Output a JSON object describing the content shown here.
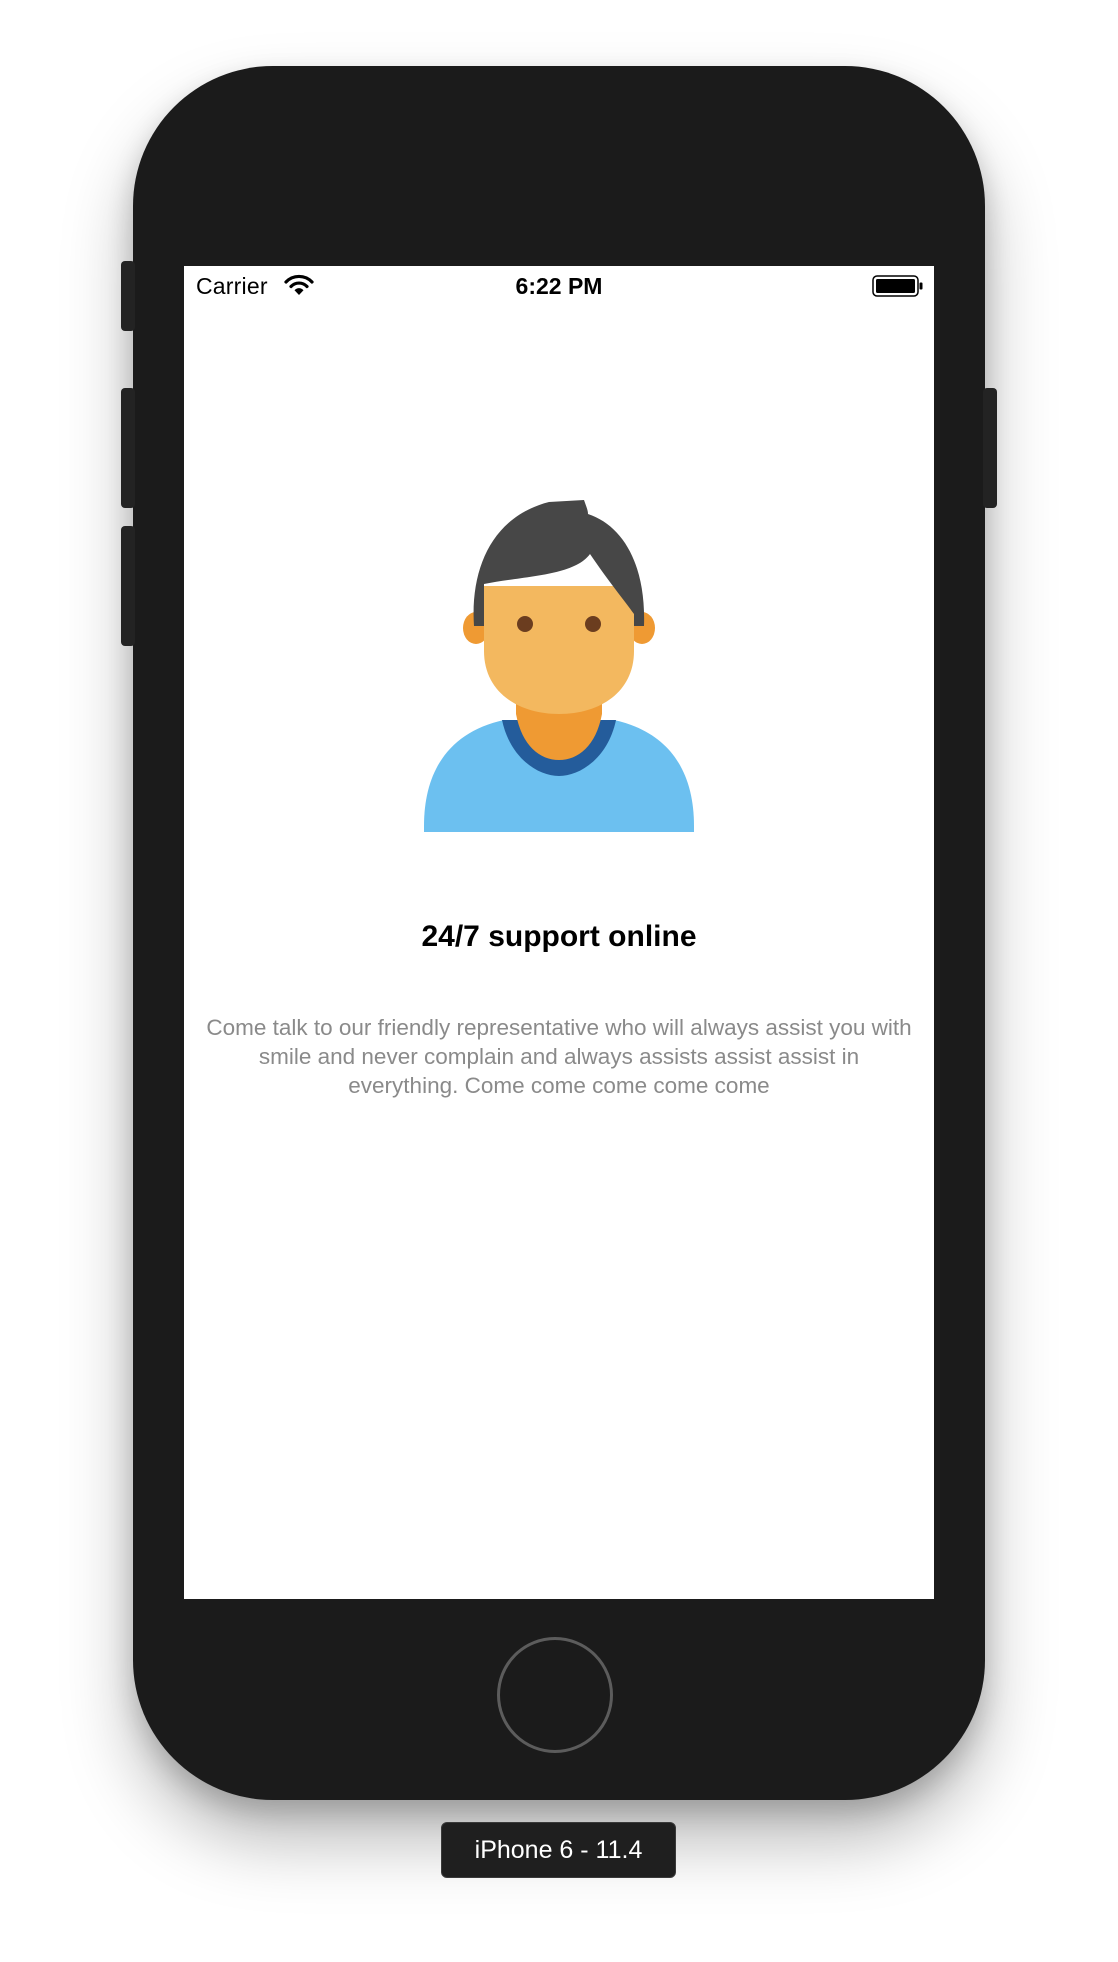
{
  "status_bar": {
    "carrier": "Carrier",
    "time": "6:22 PM",
    "wifi_icon": "wifi-icon",
    "battery_icon": "battery-icon"
  },
  "content": {
    "illustration_icon": "person-avatar-icon",
    "title": "24/7 support online",
    "description": "Come talk to our friendly representative who will always assist you with smile and never complain and always assists assist assist in everything. Come come come come come"
  },
  "simulator": {
    "device_label": "iPhone 6 - 11.4",
    "home_button_icon": "home-button-icon"
  },
  "colors": {
    "device_body": "#1b1b1b",
    "screen_background": "#ffffff",
    "title_text": "#000000",
    "description_text": "#8a8a8a",
    "avatar_hair": "#474747",
    "avatar_skin": "#f3b85f",
    "avatar_neck": "#ef9a33",
    "avatar_shirt": "#6cc0f0",
    "avatar_collar": "#245c9b"
  }
}
